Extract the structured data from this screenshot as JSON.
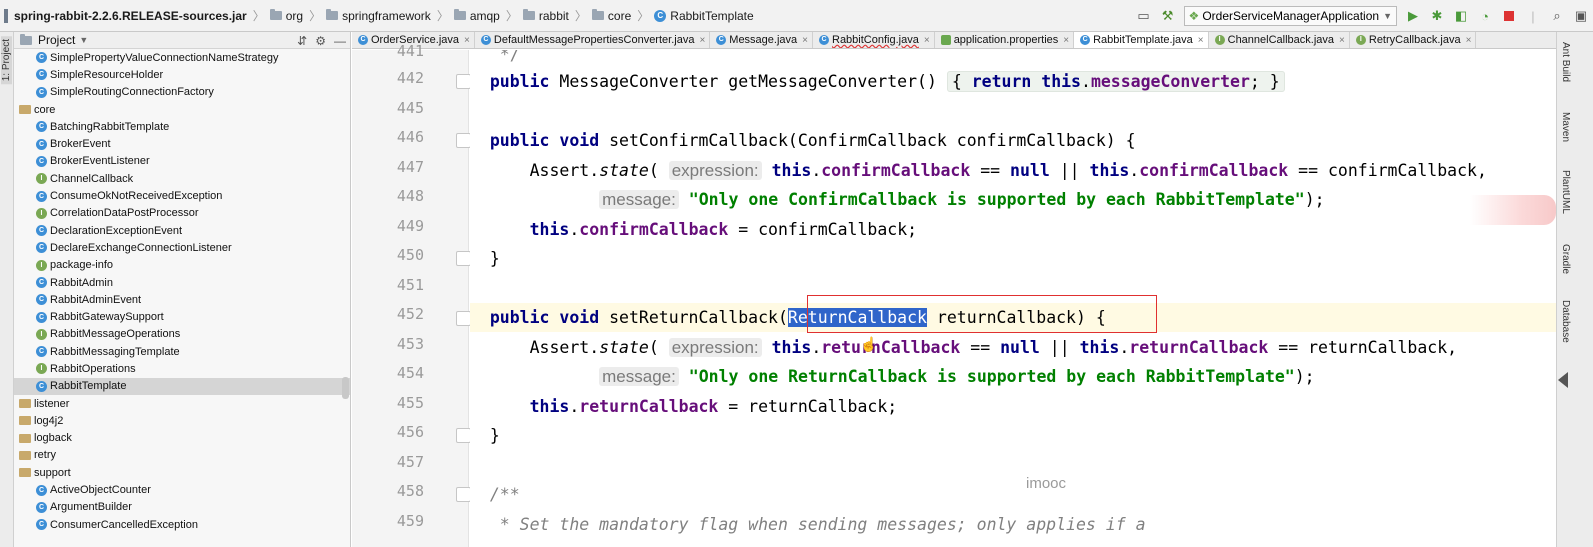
{
  "breadcrumb": {
    "jar": "spring-rabbit-2.2.6.RELEASE-sources.jar",
    "parts": [
      "org",
      "springframework",
      "amqp",
      "rabbit",
      "core"
    ],
    "current": "RabbitTemplate"
  },
  "toolbar": {
    "run_config": "OrderServiceManagerApplication"
  },
  "left_stripe": {
    "project_tab": "1: Project"
  },
  "project": {
    "title": "Project",
    "rows": [
      {
        "label": "SimplePropertyValueConnectionNameStrategy",
        "kind": "class",
        "level": 2
      },
      {
        "label": "SimpleResourceHolder",
        "kind": "class",
        "level": 2
      },
      {
        "label": "SimpleRoutingConnectionFactory",
        "kind": "class",
        "level": 2
      },
      {
        "label": "core",
        "kind": "package",
        "level": 1
      },
      {
        "label": "BatchingRabbitTemplate",
        "kind": "class",
        "level": 2
      },
      {
        "label": "BrokerEvent",
        "kind": "class",
        "level": 2
      },
      {
        "label": "BrokerEventListener",
        "kind": "class",
        "level": 2
      },
      {
        "label": "ChannelCallback",
        "kind": "interface",
        "level": 2
      },
      {
        "label": "ConsumeOkNotReceivedException",
        "kind": "class",
        "level": 2
      },
      {
        "label": "CorrelationDataPostProcessor",
        "kind": "interface",
        "level": 2
      },
      {
        "label": "DeclarationExceptionEvent",
        "kind": "class",
        "level": 2
      },
      {
        "label": "DeclareExchangeConnectionListener",
        "kind": "class",
        "level": 2
      },
      {
        "label": "package-info",
        "kind": "interface",
        "level": 2
      },
      {
        "label": "RabbitAdmin",
        "kind": "class",
        "level": 2
      },
      {
        "label": "RabbitAdminEvent",
        "kind": "class",
        "level": 2
      },
      {
        "label": "RabbitGatewaySupport",
        "kind": "class",
        "level": 2
      },
      {
        "label": "RabbitMessageOperations",
        "kind": "interface",
        "level": 2
      },
      {
        "label": "RabbitMessagingTemplate",
        "kind": "class",
        "level": 2
      },
      {
        "label": "RabbitOperations",
        "kind": "interface",
        "level": 2
      },
      {
        "label": "RabbitTemplate",
        "kind": "class",
        "level": 2,
        "selected": true
      },
      {
        "label": "listener",
        "kind": "package",
        "level": 1
      },
      {
        "label": "log4j2",
        "kind": "package",
        "level": 1
      },
      {
        "label": "logback",
        "kind": "package",
        "level": 1
      },
      {
        "label": "retry",
        "kind": "package",
        "level": 1
      },
      {
        "label": "support",
        "kind": "package",
        "level": 1
      },
      {
        "label": "ActiveObjectCounter",
        "kind": "class",
        "level": 2
      },
      {
        "label": "ArgumentBuilder",
        "kind": "class",
        "level": 2
      },
      {
        "label": "ConsumerCancelledException",
        "kind": "class",
        "level": 2
      }
    ]
  },
  "tabs": [
    {
      "label": "OrderService.java",
      "icon": "class",
      "active": false
    },
    {
      "label": "DefaultMessagePropertiesConverter.java",
      "icon": "class",
      "active": false
    },
    {
      "label": "Message.java",
      "icon": "class",
      "active": false
    },
    {
      "label": "RabbitConfig.java",
      "icon": "class",
      "active": false,
      "error": true
    },
    {
      "label": "application.properties",
      "icon": "properties",
      "active": false
    },
    {
      "label": "RabbitTemplate.java",
      "icon": "class",
      "active": true
    },
    {
      "label": "ChannelCallback.java",
      "icon": "interface",
      "active": false
    },
    {
      "label": "RetryCallback.java",
      "icon": "interface",
      "active": false
    }
  ],
  "line_numbers": [
    "441",
    "442",
    "445",
    "446",
    "447",
    "448",
    "449",
    "450",
    "451",
    "452",
    "453",
    "454",
    "455",
    "456",
    "457",
    "458",
    "459"
  ],
  "code": {
    "l442_a": "public",
    "l442_b": " MessageConverter getMessageConverter() ",
    "l442_c": "{ ",
    "l442_d": "return this",
    "l442_e": ".",
    "l442_f": "messageConverter",
    "l442_g": "; }",
    "l446_a": "public void",
    "l446_b": " setConfirmCallback(ConfirmCallback confirmCallback) {",
    "l447_a": "Assert.",
    "l447_b": "state",
    "l447_c": "( ",
    "l447_hint": "expression:",
    "l447_d": " this",
    "l447_e": ".",
    "l447_f": "confirmCallback",
    "l447_g": " == ",
    "l447_h": "null",
    "l447_i": " || ",
    "l447_j": "this",
    "l447_k": ".",
    "l447_l": "confirmCallback",
    "l447_m": " == confirmCallback,",
    "l448_hint": "message:",
    "l448_str": " \"Only one ConfirmCallback is supported by each RabbitTemplate\"",
    "l448_end": ");",
    "l449_a": "this",
    "l449_b": ".",
    "l449_c": "confirmCallback",
    "l449_d": " = confirmCallback;",
    "l450": "}",
    "l452_a": "public void",
    "l452_b": " setReturnCallback(",
    "l452_sel": "ReturnCallback",
    "l452_c": " returnCallback) {",
    "l453_a": "Assert.",
    "l453_b": "state",
    "l453_c": "( ",
    "l453_hint": "expression:",
    "l453_d": " this",
    "l453_e": ".",
    "l453_f": "returnCallback",
    "l453_g": " == ",
    "l453_h": "null",
    "l453_i": " || ",
    "l453_j": "this",
    "l453_k": ".",
    "l453_l": "returnCallback",
    "l453_m": " == returnCallback,",
    "l454_hint": "message:",
    "l454_str": " \"Only one ReturnCallback is supported by each RabbitTemplate\"",
    "l454_end": ");",
    "l455_a": "this",
    "l455_b": ".",
    "l455_c": "returnCallback",
    "l455_d": " = returnCallback;",
    "l456": "}",
    "l458": "/**",
    "l459": " * Set the mandatory flag when sending messages; only applies if a"
  },
  "watermark": "imooc",
  "right_stripe": [
    "Ant Build",
    "Maven",
    "PlantUML",
    "Gradle",
    "Database"
  ],
  "colors": {
    "keyword": "#000080",
    "field": "#660e7a",
    "string": "#008000",
    "selection": "#2f65ca",
    "annotation_box": "#e03030"
  }
}
